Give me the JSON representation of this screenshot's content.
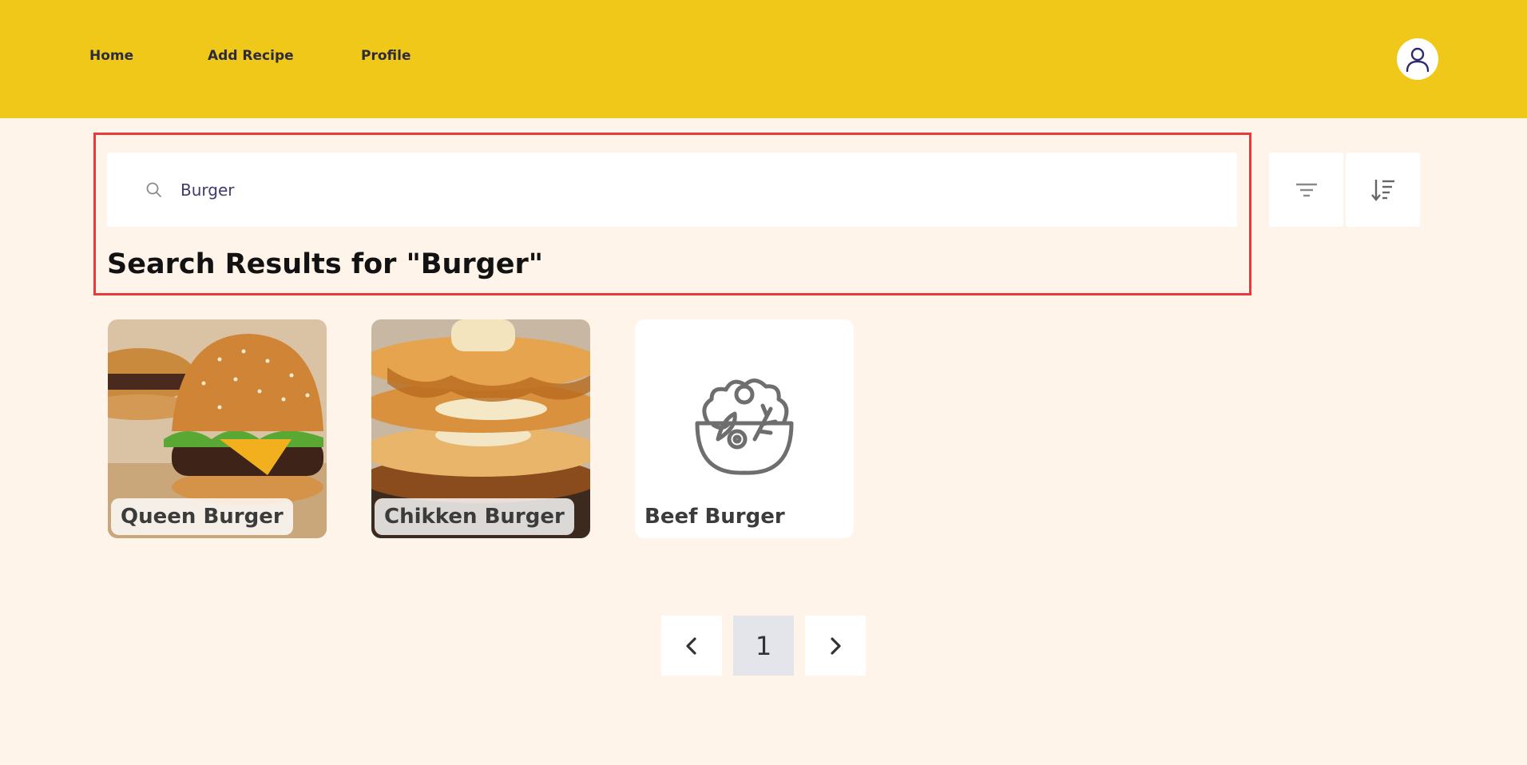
{
  "nav": {
    "links": [
      {
        "label": "Home"
      },
      {
        "label": "Add Recipe"
      },
      {
        "label": "Profile"
      }
    ],
    "avatar_icon": "user-icon"
  },
  "search": {
    "value": "Burger",
    "placeholder": "",
    "icon": "search-icon"
  },
  "tools": {
    "filter_icon": "filter-icon",
    "sort_icon": "sort-descending-icon"
  },
  "results": {
    "title": "Search Results for \"Burger\""
  },
  "recipes": [
    {
      "name": "Queen Burger",
      "image": "burger-photo"
    },
    {
      "name": "Chikken Burger",
      "image": "pancake-stack-photo"
    },
    {
      "name": "Beef Burger",
      "image": "salad-bowl-icon"
    }
  ],
  "pagination": {
    "current": "1",
    "prev_icon": "chevron-left-icon",
    "next_icon": "chevron-right-icon"
  },
  "colors": {
    "topbar": "#efc81a",
    "page_background": "#fff4ea",
    "highlight": "#e83a3a"
  }
}
